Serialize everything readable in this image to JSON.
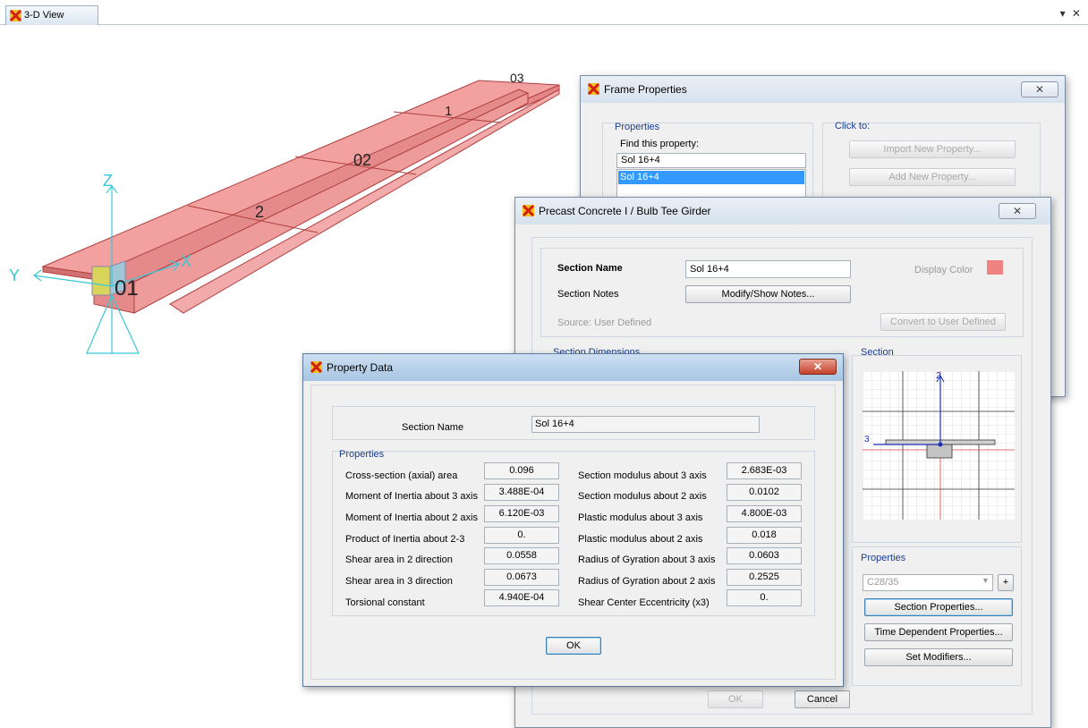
{
  "tab": {
    "label": "3-D View",
    "controls": "▾ ✕"
  },
  "viewport": {
    "labels": {
      "z": "Z",
      "y": "Y",
      "x": "X",
      "n01": "01",
      "n02": "02",
      "n03": "03",
      "n1": "1",
      "n2": "2"
    }
  },
  "frame_props": {
    "title": "Frame Properties",
    "close": "✕",
    "properties_group": "Properties",
    "find_label": "Find this property:",
    "search_value": "Sol 16+4",
    "list": [
      "Sol 16+4"
    ],
    "click_to": "Click to:",
    "import_button": "Import New Property...",
    "add_button": "Add New Property..."
  },
  "girder": {
    "title": "Precast Concrete I / Bulb Tee Girder",
    "close": "✕",
    "section_name_label": "Section Name",
    "section_name_value": "Sol 16+4",
    "section_notes_label": "Section Notes",
    "modify_notes_button": "Modify/Show Notes...",
    "display_color_label": "Display Color",
    "display_color": "#f08282",
    "source_label": "Source:  User Defined",
    "convert_button": "Convert to User Defined",
    "dimensions_group": "Section Dimensions",
    "section_group": "Section",
    "axis_2": "2",
    "axis_3": "3",
    "properties_group": "Properties",
    "material_value": "C28/35",
    "plus_button": "+",
    "section_properties_button": "Section Properties...",
    "time_dependent_button": "Time Dependent Properties...",
    "set_modifiers_button": "Set Modifiers...",
    "ok_button": "OK",
    "cancel_button": "Cancel"
  },
  "property_data": {
    "title": "Property Data",
    "close": "✕",
    "section_name_label": "Section Name",
    "section_name_value": "Sol 16+4",
    "properties_group": "Properties",
    "left": [
      {
        "label": "Cross-section (axial) area",
        "value": "0.096"
      },
      {
        "label": "Moment of Inertia about 3 axis",
        "value": "3.488E-04"
      },
      {
        "label": "Moment of Inertia about 2 axis",
        "value": "6.120E-03"
      },
      {
        "label": "Product of Inertia about 2-3",
        "value": "0."
      },
      {
        "label": "Shear area in 2 direction",
        "value": "0.0558"
      },
      {
        "label": "Shear area in 3 direction",
        "value": "0.0673"
      },
      {
        "label": "Torsional constant",
        "value": "4.940E-04"
      }
    ],
    "right": [
      {
        "label": "Section modulus about 3 axis",
        "value": "2.683E-03"
      },
      {
        "label": "Section modulus about 2 axis",
        "value": "0.0102"
      },
      {
        "label": "Plastic modulus about 3 axis",
        "value": "4.800E-03"
      },
      {
        "label": "Plastic modulus about 2 axis",
        "value": "0.018"
      },
      {
        "label": "Radius of Gyration about 3 axis",
        "value": "0.0603"
      },
      {
        "label": "Radius of Gyration about 2 axis",
        "value": "0.2525"
      },
      {
        "label": "Shear Center Eccentricity (x3)",
        "value": "0."
      }
    ],
    "ok_button": "OK"
  }
}
